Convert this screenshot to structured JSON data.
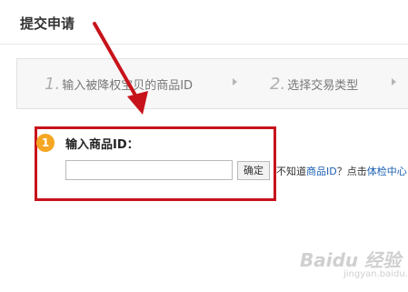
{
  "header": {
    "title": "提交申请"
  },
  "steps": [
    {
      "num": "1.",
      "label": "输入被降权宝贝的商品ID"
    },
    {
      "num": "2.",
      "label": "选择交易类型"
    }
  ],
  "form": {
    "badge": "1",
    "label": "输入商品ID：",
    "input_value": "",
    "input_placeholder": "",
    "confirm_label": "确定",
    "help_prefix": "不知道",
    "help_link1": "商品ID",
    "help_mid": "？点击",
    "help_link2": "体检中心"
  },
  "watermark": {
    "brand": "Baidu 经验",
    "sub": "jingyan.baidu.com"
  },
  "colors": {
    "highlight": "#c8121b",
    "badge": "#f5a623",
    "link": "#1a5fb4"
  }
}
